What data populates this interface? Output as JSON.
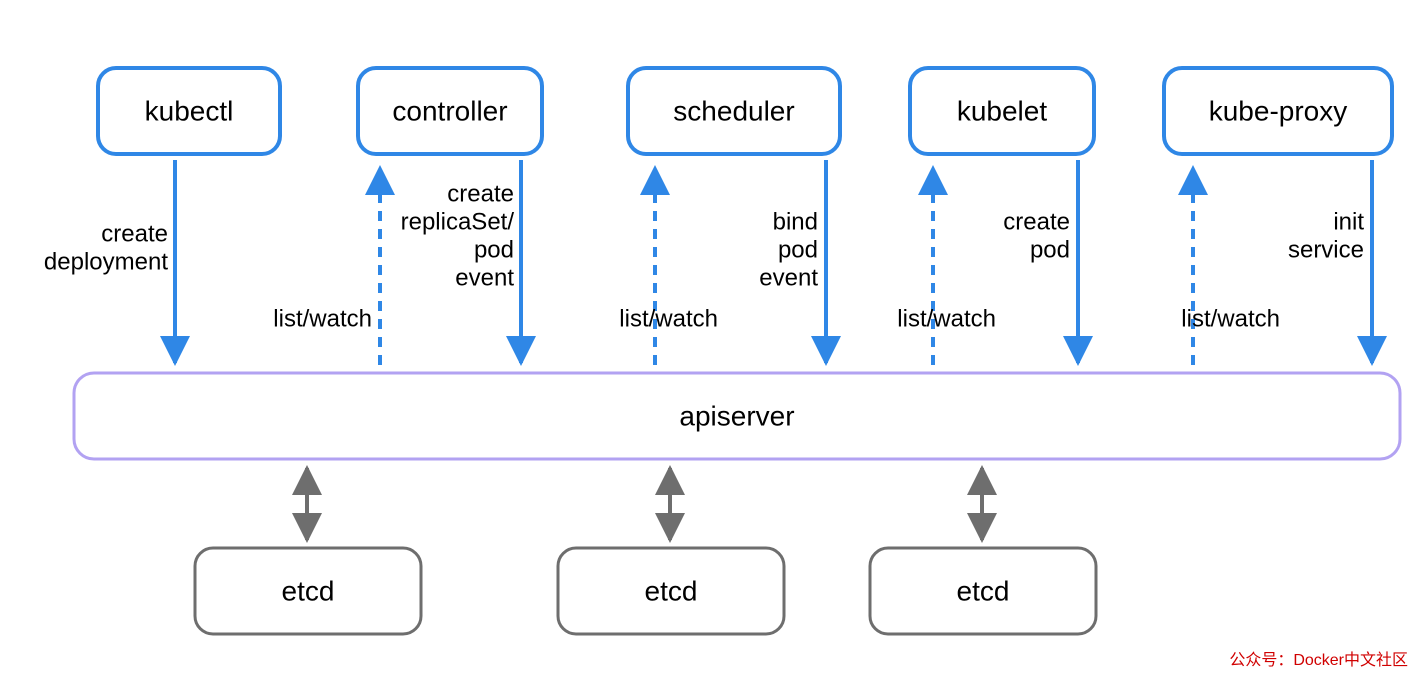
{
  "nodes": {
    "kubectl": "kubectl",
    "controller": "controller",
    "scheduler": "scheduler",
    "kubelet": "kubelet",
    "kubeproxy": "kube-proxy",
    "apiserver": "apiserver",
    "etcd1": "etcd",
    "etcd2": "etcd",
    "etcd3": "etcd"
  },
  "edges": {
    "kubectl_down_l1": "create",
    "kubectl_down_l2": "deployment",
    "controller_up": "list/watch",
    "controller_down_l1": "create",
    "controller_down_l2": "replicaSet/",
    "controller_down_l3": "pod",
    "controller_down_l4": "event",
    "scheduler_up": "list/watch",
    "scheduler_down_l1": "bind",
    "scheduler_down_l2": "pod",
    "scheduler_down_l3": "event",
    "kubelet_up": "list/watch",
    "kubelet_down_l1": "create",
    "kubelet_down_l2": "pod",
    "kubeproxy_up": "list/watch",
    "kubeproxy_down_l1": "init",
    "kubeproxy_down_l2": "service"
  },
  "credit": "公众号：Docker中文社区"
}
